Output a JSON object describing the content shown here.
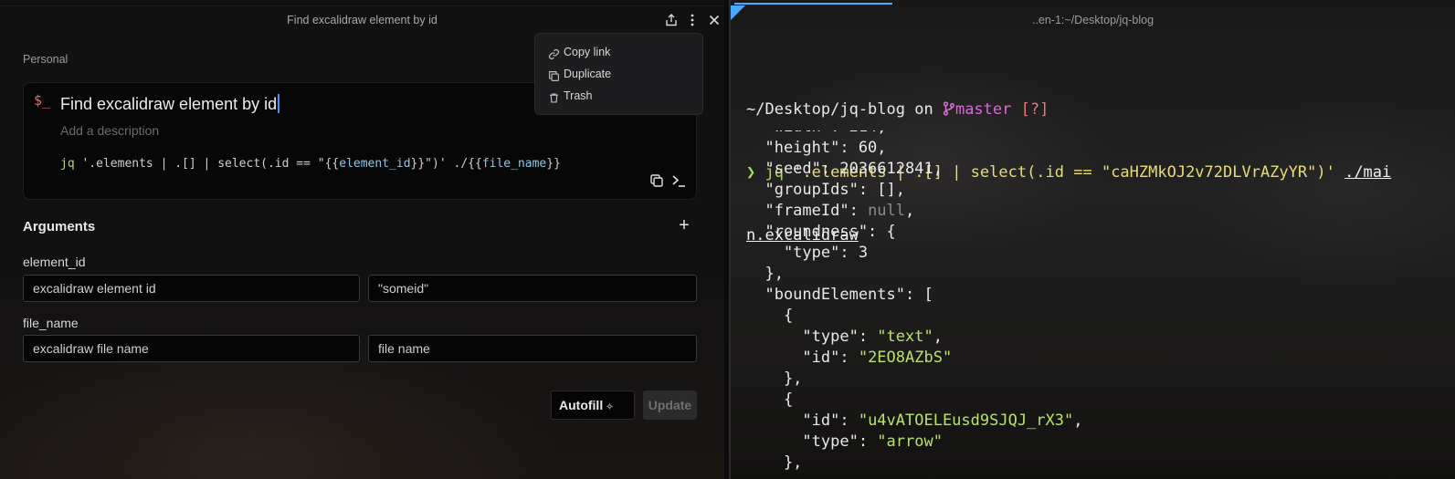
{
  "left_panel": {
    "window_title": "Find excalidraw element by id",
    "workspace": "Personal",
    "command": {
      "prompt_glyph": "$_",
      "title": "Find excalidraw element by id",
      "description_placeholder": "Add a description",
      "code_parts": {
        "kw": "jq",
        "a": " '.elements | .[] | select(.id == \"{{",
        "v1": "element_id",
        "b": "}}\")' ./{{",
        "v2": "file_name",
        "c": "}}"
      }
    },
    "menu": {
      "items": [
        {
          "label": "Copy link",
          "icon": "link-icon"
        },
        {
          "label": "Duplicate",
          "icon": "duplicate-icon"
        },
        {
          "label": "Trash",
          "icon": "trash-icon"
        }
      ]
    },
    "arguments": {
      "title": "Arguments",
      "add_label": "+",
      "items": [
        {
          "name": "element_id",
          "description": "excalidraw element id",
          "default": "\"someid\""
        },
        {
          "name": "file_name",
          "description": "excalidraw file name",
          "default_placeholder": "file name"
        }
      ]
    },
    "buttons": {
      "autofill": "Autofill",
      "autofill_icon": "✧",
      "update": "Update"
    }
  },
  "terminal": {
    "title": "..en-1:~/Desktop/jq-blog",
    "prompt": {
      "path": "~/Desktop/jq-blog",
      "on": " on ",
      "branch_icon": "",
      "branch": "master",
      "status": "[?]"
    },
    "command": {
      "arrow": "❯",
      "cmd": " jq ",
      "filter": "'.elements | .[] | select(.id == \"caHZMkOJ2v72DLVrAZyYR\")'",
      "path1": "./mai",
      "path2": "n.excalidraw"
    },
    "output": [
      [
        "  \"width\": 214,",
        ""
      ],
      [
        "  \"height\": 60,",
        ""
      ],
      [
        "  \"seed\": 2036612841,",
        ""
      ],
      [
        "  \"groupIds\": [],",
        ""
      ],
      [
        "  \"frameId\": ",
        "null",
        ","
      ],
      [
        "  \"roundness\": {",
        ""
      ],
      [
        "    \"type\": 3",
        ""
      ],
      [
        "  },",
        ""
      ],
      [
        "  \"boundElements\": [",
        ""
      ],
      [
        "    {",
        ""
      ],
      [
        "      \"type\": ",
        "\"text\"",
        ","
      ],
      [
        "      \"id\": ",
        "\"2EO8AZbS\"",
        ""
      ],
      [
        "    },",
        ""
      ],
      [
        "    {",
        ""
      ],
      [
        "      \"id\": ",
        "\"u4vATOELEusd9SJQJ_rX3\"",
        ","
      ],
      [
        "      \"type\": ",
        "\"arrow\"",
        ""
      ],
      [
        "    },",
        ""
      ]
    ]
  }
}
